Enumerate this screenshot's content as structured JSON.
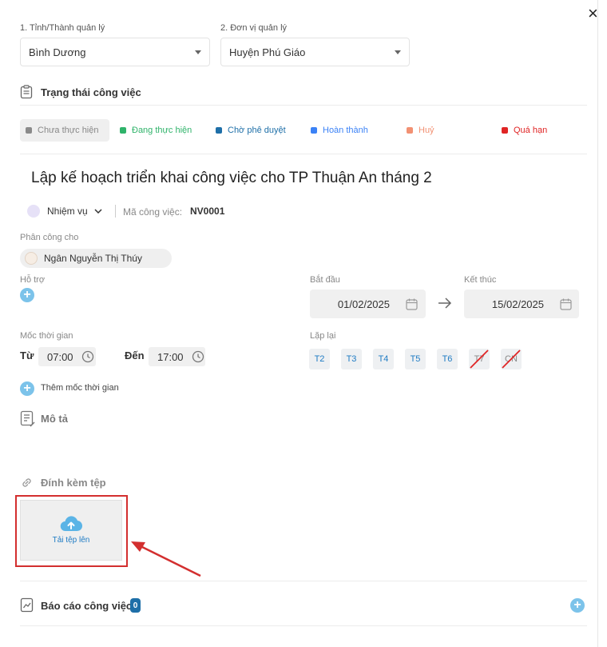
{
  "close_label": "×",
  "province": {
    "label": "1. Tỉnh/Thành quản lý",
    "value": "Bình Dương"
  },
  "unit": {
    "label": "2. Đơn vị quản lý",
    "value": "Huyện Phú Giáo"
  },
  "status_section": {
    "title": "Trạng thái công việc",
    "items": [
      {
        "label": "Chưa thực hiện",
        "color": "#8a8a8a"
      },
      {
        "label": "Đang thực hiện",
        "color": "#2fb36a"
      },
      {
        "label": "Chờ phê duyệt",
        "color": "#1e6fa8"
      },
      {
        "label": "Hoàn thành",
        "color": "#3b82f6"
      },
      {
        "label": "Huỷ",
        "color": "#f29173"
      },
      {
        "label": "Quá hạn",
        "color": "#e02424"
      }
    ]
  },
  "task": {
    "title": "Lập kế hoạch triển khai công việc cho TP Thuận An tháng 2",
    "type": "Nhiệm vụ",
    "code_label": "Mã công việc:",
    "code": "NV0001"
  },
  "assign": {
    "label": "Phân công cho",
    "name": "Ngân Nguyễn Thị Thúy"
  },
  "support": {
    "label": "Hỗ trợ"
  },
  "dates": {
    "start_label": "Bắt đầu",
    "start": "01/02/2025",
    "end_label": "Kết thúc",
    "end": "15/02/2025"
  },
  "milestone": {
    "label": "Mốc thời gian",
    "from_label": "Từ",
    "from": "07:00",
    "to_label": "Đến",
    "to": "17:00",
    "add_label": "Thêm mốc thời gian"
  },
  "repeat": {
    "label": "Lặp lại",
    "days": [
      "T2",
      "T3",
      "T4",
      "T5",
      "T6",
      "T7",
      "CN"
    ]
  },
  "description": {
    "label": "Mô tả"
  },
  "attachment": {
    "label": "Đính kèm tệp",
    "upload_label": "Tải tệp lên"
  },
  "report": {
    "label": "Báo cáo công việc",
    "count": "0"
  },
  "colors": {
    "accent": "#1e7bc4",
    "highlight_red": "#d32f2f",
    "plus_blue": "#7cc3ea"
  }
}
